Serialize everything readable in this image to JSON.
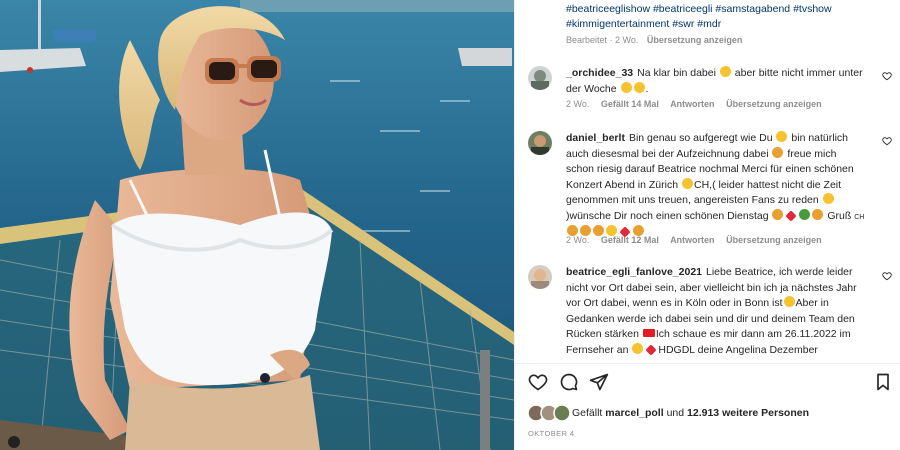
{
  "caption": {
    "hashtags_line1": "#beatriceeglishow #beatriceegli #samstagabend #tvshow",
    "hashtags_line2": "#kimmigentertainment #swr #mdr",
    "edited": "Bearbeitet · 2 Wo.",
    "translate": "Übersetzung anzeigen"
  },
  "comments": [
    {
      "user": "_orchidee_33",
      "text_a": "Na klar bin dabei",
      "text_b": "aber bitte nicht immer unter der Woche",
      "time": "2 Wo.",
      "likes": "Gefällt 14 Mal",
      "reply": "Antworten",
      "translate": "Übersetzung anzeigen"
    },
    {
      "user": "daniel_berlt",
      "text_a": "Bin genau so aufgeregt wie Du",
      "text_b": "bin natürlich auch diesesmal bei der Aufzeichnung dabei",
      "text_c": "freue mich schon riesig darauf Beatrice nochmal Merci für einen schönen Konzert Abend in Zürich",
      "text_d": "CH,( leider hattest nicht die Zeit genommen mit uns treuen, angereisten Fans zu reden",
      "text_e": ")wünsche Dir noch einen schönen Dienstag",
      "text_f": "Gruß",
      "text_g": "CH",
      "time": "2 Wo.",
      "likes": "Gefällt 12 Mal",
      "reply": "Antworten",
      "translate": "Übersetzung anzeigen"
    },
    {
      "user": "beatrice_egli_fanlove_2021",
      "text_a": "Liebe Beatrice, ich werde leider nicht vor Ort dabei sein, aber vielleicht bin ich ja nächstes Jahr vor Ort dabei, wenn es in Köln oder in Bonn ist",
      "text_b": "Aber in Gedanken werde ich dabei sein und dir und deinem Team den Rücken stärken",
      "text_c": "Ich schaue es mir dann am 26.11.2022 im Fernseher an",
      "text_d": "HDGDL deine Angelina Dezember"
    }
  ],
  "likes": {
    "prefix": "Gefällt",
    "user": "marcel_poll",
    "middle": "und",
    "count": "12.913 weitere Personen"
  },
  "date": "OKTOBER 4",
  "colors": {
    "link": "#00376b",
    "meta": "#8e8e8e",
    "text": "#262626"
  },
  "icons": [
    "heart-icon",
    "comment-icon",
    "share-icon",
    "bookmark-icon"
  ]
}
